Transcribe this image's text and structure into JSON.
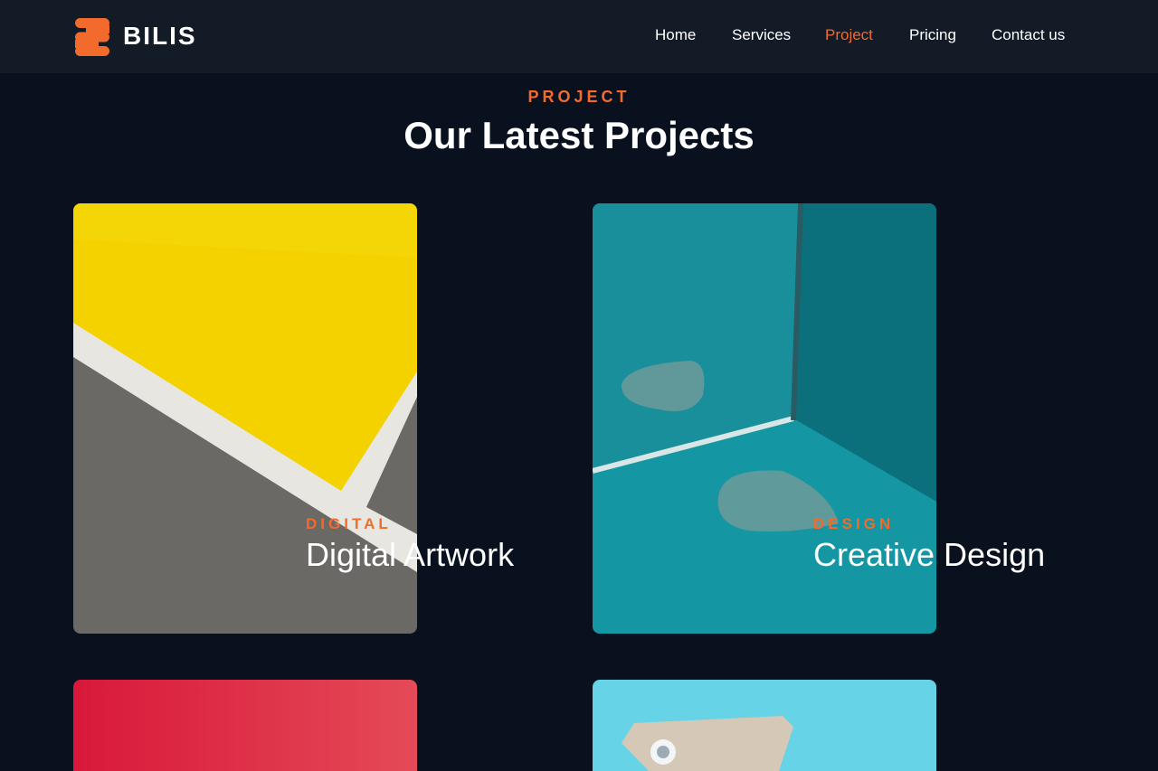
{
  "brand": {
    "name": "BILIS",
    "accent_color": "#f26b2d",
    "logo_icon": "stacked-bars-logo-icon"
  },
  "nav": {
    "items": [
      {
        "label": "Home",
        "active": false
      },
      {
        "label": "Services",
        "active": false
      },
      {
        "label": "Project",
        "active": true
      },
      {
        "label": "Pricing",
        "active": false
      },
      {
        "label": "Contact us",
        "active": false
      }
    ]
  },
  "section": {
    "eyebrow": "PROJECT",
    "title": "Our Latest Projects"
  },
  "projects": [
    {
      "category": "DIGITAL",
      "title": "Digital Artwork",
      "image": "yellow-gray-abstract-image"
    },
    {
      "category": "DESIGN",
      "title": "Creative Design",
      "image": "teal-guitar-picks-mirror-image"
    },
    {
      "category": "",
      "title": "",
      "image": "red-abstract-image"
    },
    {
      "category": "",
      "title": "",
      "image": "cyan-paper-tag-image"
    }
  ],
  "colors": {
    "background": "#0a111e",
    "header": "#131b27",
    "accent": "#f26b2d"
  }
}
